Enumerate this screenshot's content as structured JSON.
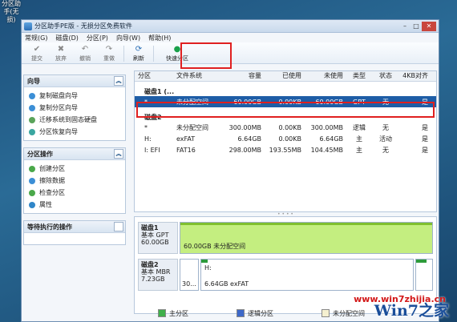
{
  "desktop": {
    "icon_label_line1": "分区助手(无",
    "icon_label_line2": "损)"
  },
  "window": {
    "title": "分区助手PE版 - 无损分区免费软件",
    "min": "–",
    "max": "□",
    "close": "✕"
  },
  "menu": [
    "常规(G)",
    "磁盘(D)",
    "分区(P)",
    "向导(W)",
    "帮助(H)"
  ],
  "toolbar": {
    "commit": "提交",
    "discard": "放弃",
    "undo": "撤销",
    "redo": "重做",
    "refresh": "刷新",
    "quick_partition": "快速分区"
  },
  "wizard_panel": {
    "title": "向导",
    "items": [
      "复制磁盘向导",
      "复制分区向导",
      "迁移系统到固态硬盘",
      "分区恢复向导"
    ]
  },
  "partition_panel": {
    "title": "分区操作",
    "items": [
      "创建分区",
      "擦除数据",
      "检查分区",
      "属性"
    ]
  },
  "pending_panel": {
    "title": "等待执行的操作"
  },
  "table": {
    "headers": [
      "分区",
      "文件系统",
      "容量",
      "已使用",
      "未使用",
      "类型",
      "状态",
      "4KB对齐"
    ],
    "disk1_label": "磁盘1 (...",
    "disk1_rows": [
      [
        "*",
        "未分配空间",
        "60.00GB",
        "0.00KB",
        "60.00GB",
        "GPT",
        "无",
        "是"
      ]
    ],
    "disk2_label": "磁盘2",
    "disk2_rows": [
      [
        "*",
        "未分配空间",
        "300.00MB",
        "0.00KB",
        "300.00MB",
        "逻辑",
        "无",
        "是"
      ],
      [
        "H:",
        "exFAT",
        "6.64GB",
        "0.00KB",
        "6.64GB",
        "主",
        "活动",
        "是"
      ],
      [
        "I: EFI",
        "FAT16",
        "298.00MB",
        "193.55MB",
        "104.45MB",
        "主",
        "无",
        "是"
      ]
    ]
  },
  "diskmap": {
    "disk1": {
      "name": "磁盘1",
      "type": "基本 GPT",
      "size": "60.00GB",
      "bar_text": "60.00GB 未分配空间"
    },
    "disk2": {
      "name": "磁盘2",
      "type": "基本 MBR",
      "size": "7.23GB",
      "part1_text": "30...",
      "part2_title": "H:",
      "part2_text": "6.64GB exFAT"
    }
  },
  "legend": [
    "主分区",
    "逻辑分区",
    "未分配空间"
  ],
  "watermark": "www.win7zhijia.cn",
  "brand": "Win7之家",
  "colors": {
    "selected": "#1e5da6",
    "primary": "#3fb04b",
    "logical": "#3d68c9",
    "unallocated": "#f5f0d0",
    "highlight": "#e02020"
  }
}
